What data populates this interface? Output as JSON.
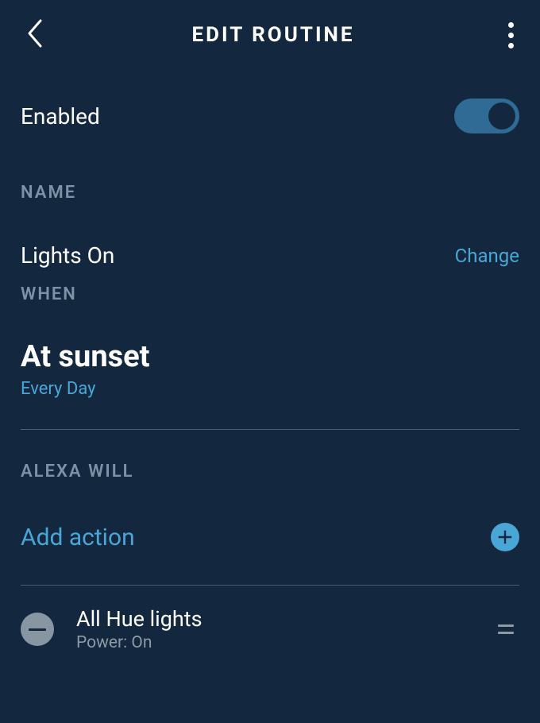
{
  "header": {
    "title": "EDIT ROUTINE"
  },
  "enabled": {
    "label": "Enabled",
    "state": true
  },
  "sections": {
    "name_label": "NAME",
    "when_label": "WHEN",
    "alexa_will_label": "ALEXA WILL"
  },
  "name": {
    "value": "Lights On",
    "change_label": "Change"
  },
  "when": {
    "value": "At sunset",
    "sub": "Every Day"
  },
  "actions": {
    "add_label": "Add action",
    "items": [
      {
        "title": "All Hue lights",
        "sub": "Power: On"
      }
    ]
  }
}
